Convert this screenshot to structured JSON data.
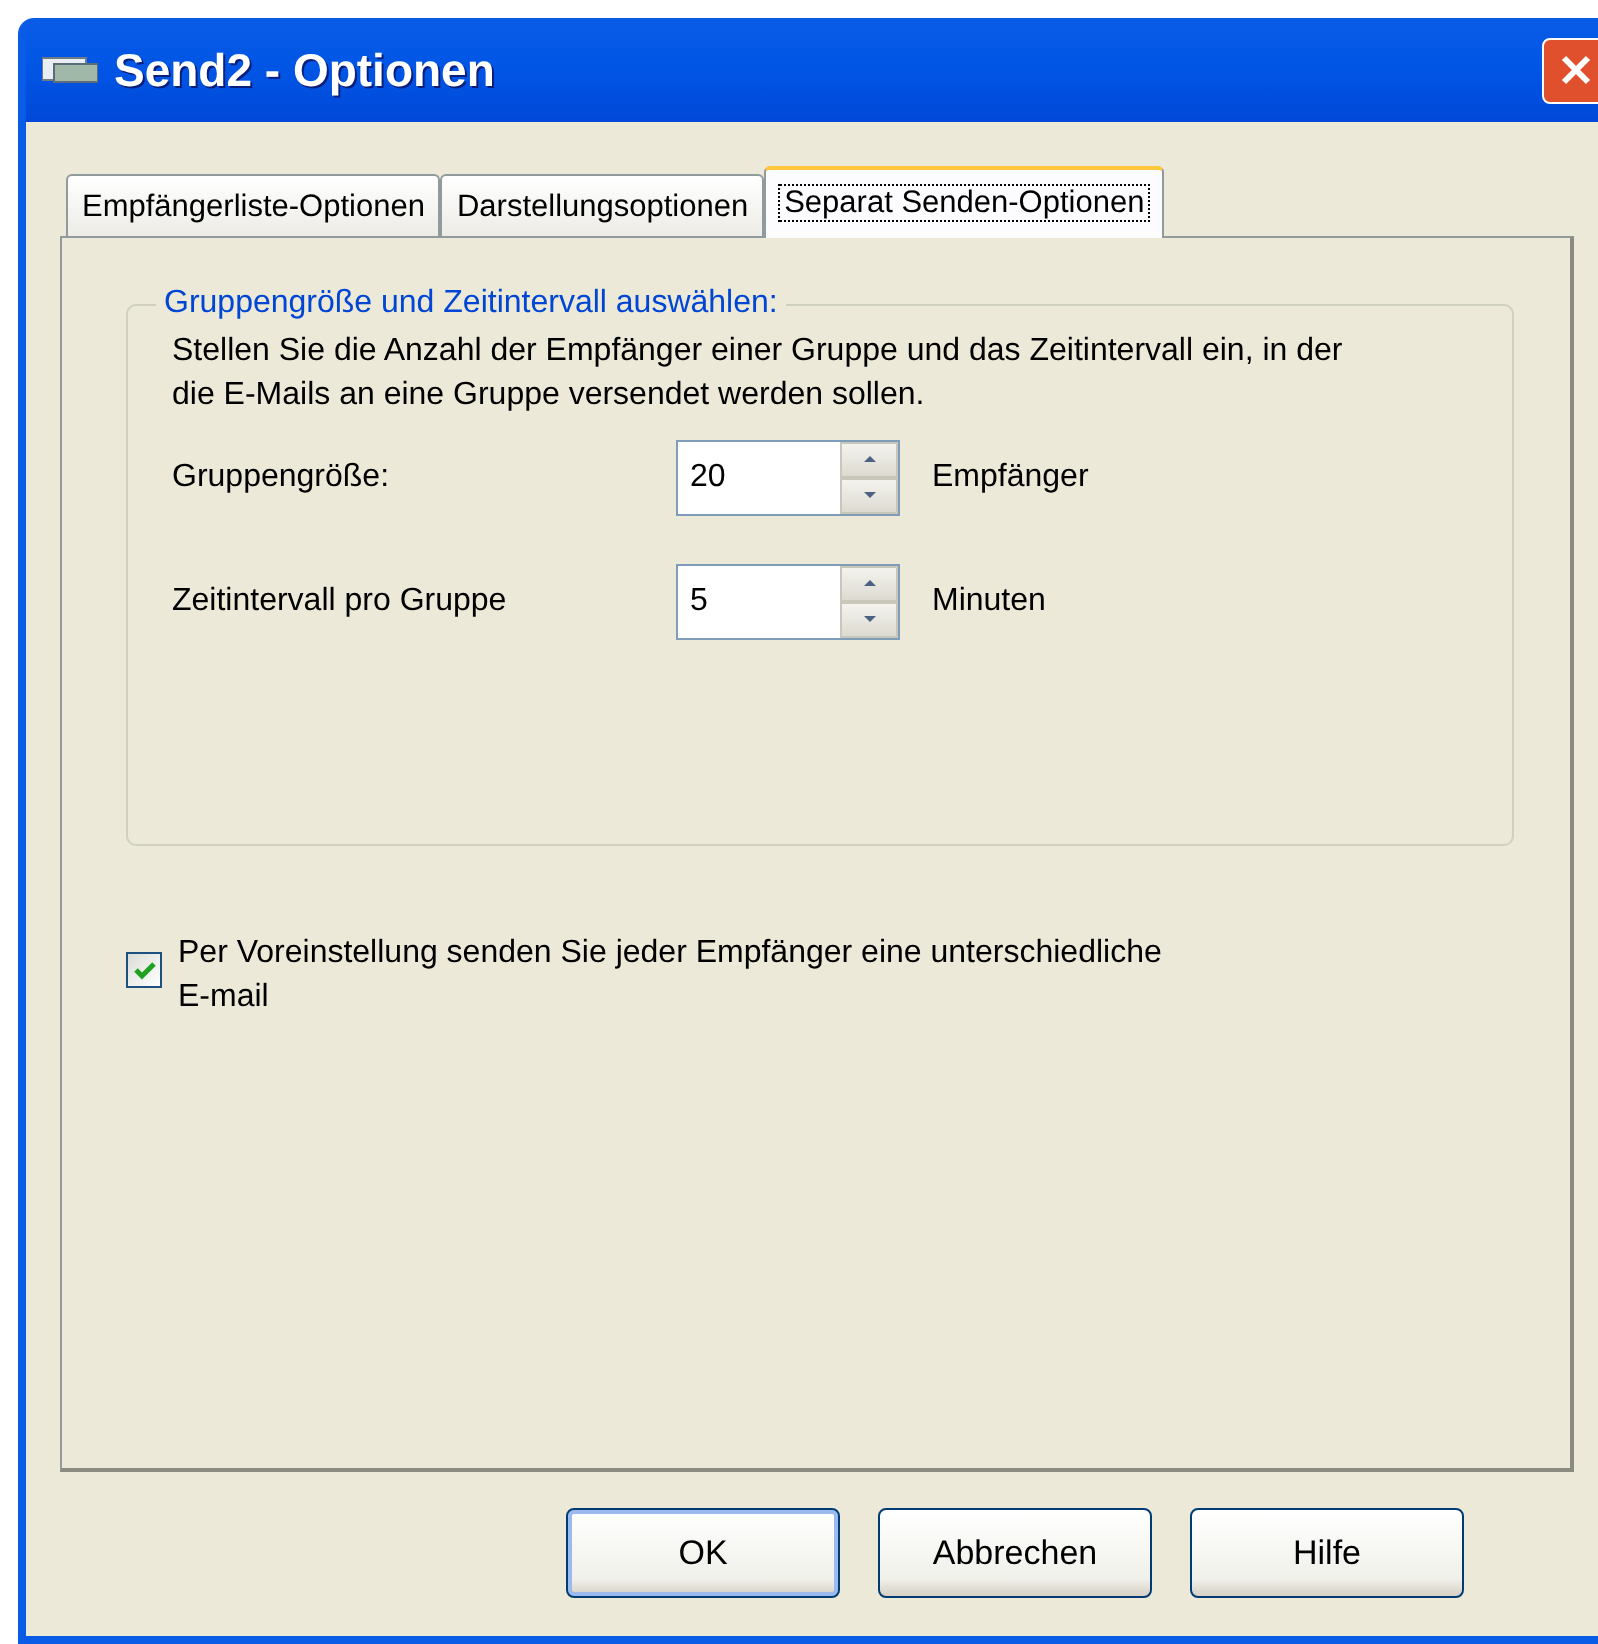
{
  "window": {
    "title": "Send2 - Optionen"
  },
  "tabs": [
    {
      "label": "Empfängerliste-Optionen",
      "selected": false
    },
    {
      "label": "Darstellungsoptionen",
      "selected": false
    },
    {
      "label": "Separat Senden-Optionen",
      "selected": true
    }
  ],
  "group": {
    "title": "Gruppengröße und Zeitintervall auswählen:",
    "description": "Stellen Sie die Anzahl der Empfänger einer Gruppe und das Zeitintervall ein, in der die E-Mails an eine Gruppe versendet werden sollen.",
    "fields": [
      {
        "label": "Gruppengröße:",
        "value": "20",
        "unit": "Empfänger"
      },
      {
        "label": "Zeitintervall pro Gruppe",
        "value": "5",
        "unit": "Minuten"
      }
    ]
  },
  "checkbox": {
    "label": "Per Voreinstellung senden Sie jeder Empfänger eine unterschiedliche E-mail",
    "checked": true
  },
  "buttons": [
    {
      "label": "OK",
      "default": true
    },
    {
      "label": "Abbrechen",
      "default": false
    },
    {
      "label": "Hilfe",
      "default": false
    }
  ]
}
